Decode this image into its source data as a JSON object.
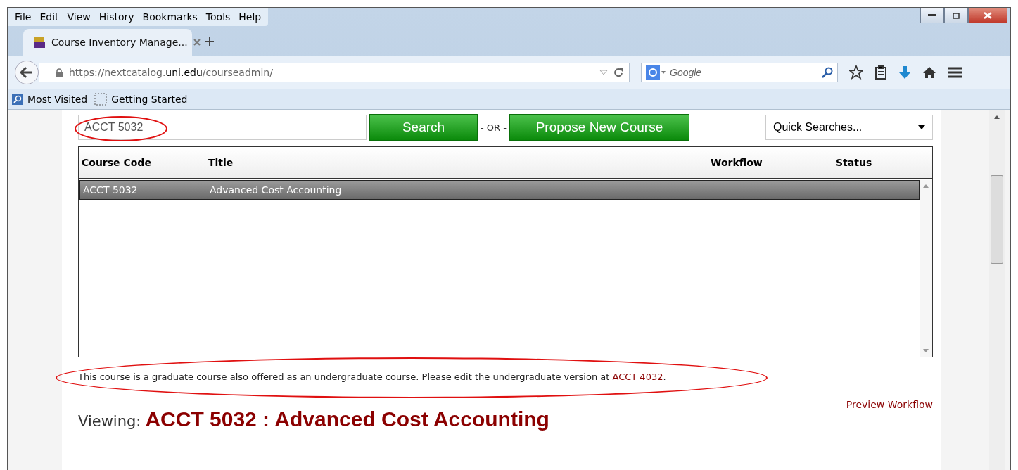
{
  "menu_bar": [
    "File",
    "Edit",
    "View",
    "History",
    "Bookmarks",
    "Tools",
    "Help"
  ],
  "tabs": [
    {
      "label": "Course Inventory Manage...",
      "selected": true
    }
  ],
  "address_bar": {
    "prefix": "https://nextcatalog.",
    "domain": "uni.edu",
    "path": "/courseadmin/"
  },
  "search_box": {
    "placeholder": "Google"
  },
  "bookmarks": [
    "Most Visited",
    "Getting Started"
  ],
  "page": {
    "search_field": {
      "value": "ACCT 5032"
    },
    "search_button": "Search",
    "or_label": "- OR -",
    "propose_button": "Propose New Course",
    "quick_searches": "Quick Searches...",
    "table": {
      "columns": [
        "Course Code",
        "Title",
        "Workflow",
        "Status"
      ],
      "rows": [
        {
          "cells": [
            "ACCT 5032",
            "Advanced Cost Accounting",
            "",
            ""
          ],
          "selected": true
        }
      ]
    },
    "note": {
      "before": "This course is a graduate course also offered as an undergraduate course. Please edit the undergraduate version at ",
      "link": "ACCT 4032",
      "after": "."
    },
    "preview_link": "Preview Workflow",
    "viewing_label": "Viewing:",
    "heading": "ACCT 5032 : Advanced Cost Accounting"
  }
}
